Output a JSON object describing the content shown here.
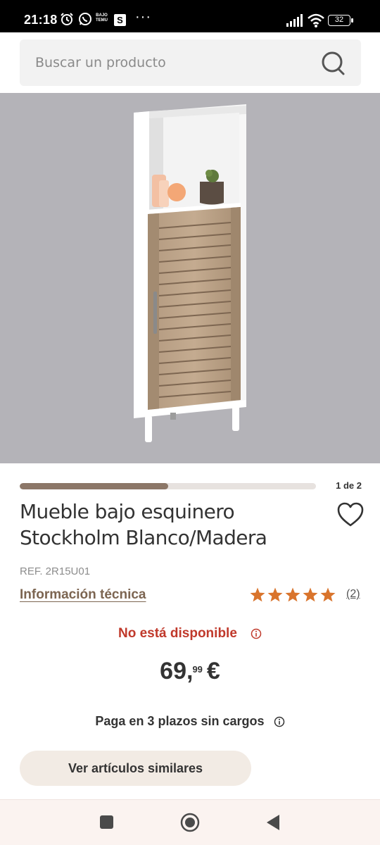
{
  "status_bar": {
    "time": "21:18",
    "temu_label": [
      "BAJO",
      "TEMU"
    ],
    "s_badge": "S",
    "more_dots": "···",
    "battery": "32"
  },
  "search": {
    "placeholder": "Buscar un producto"
  },
  "gallery": {
    "counter": "1 de 2",
    "progress_fraction": 0.5
  },
  "product": {
    "title": "Mueble bajo esquinero Stockholm Blanco/Madera",
    "ref": "REF. 2R15U01",
    "technical_info_label": "Información técnica",
    "rating": 5,
    "review_count": "(2)",
    "availability": "No está disponible",
    "price": {
      "integer": "69,",
      "decimals": "99",
      "currency": "€"
    },
    "installments": "Paga en 3 plazos sin cargos",
    "similar_button": "Ver artículos similares"
  },
  "colors": {
    "accent_brown": "#7c6551",
    "star_color": "#d9742c",
    "unavailable_red": "#c0392b",
    "image_bg": "#b4b3b8"
  },
  "icons": {
    "search": "search-icon",
    "favorite": "heart-outline-icon",
    "info": "info-circle-icon"
  }
}
